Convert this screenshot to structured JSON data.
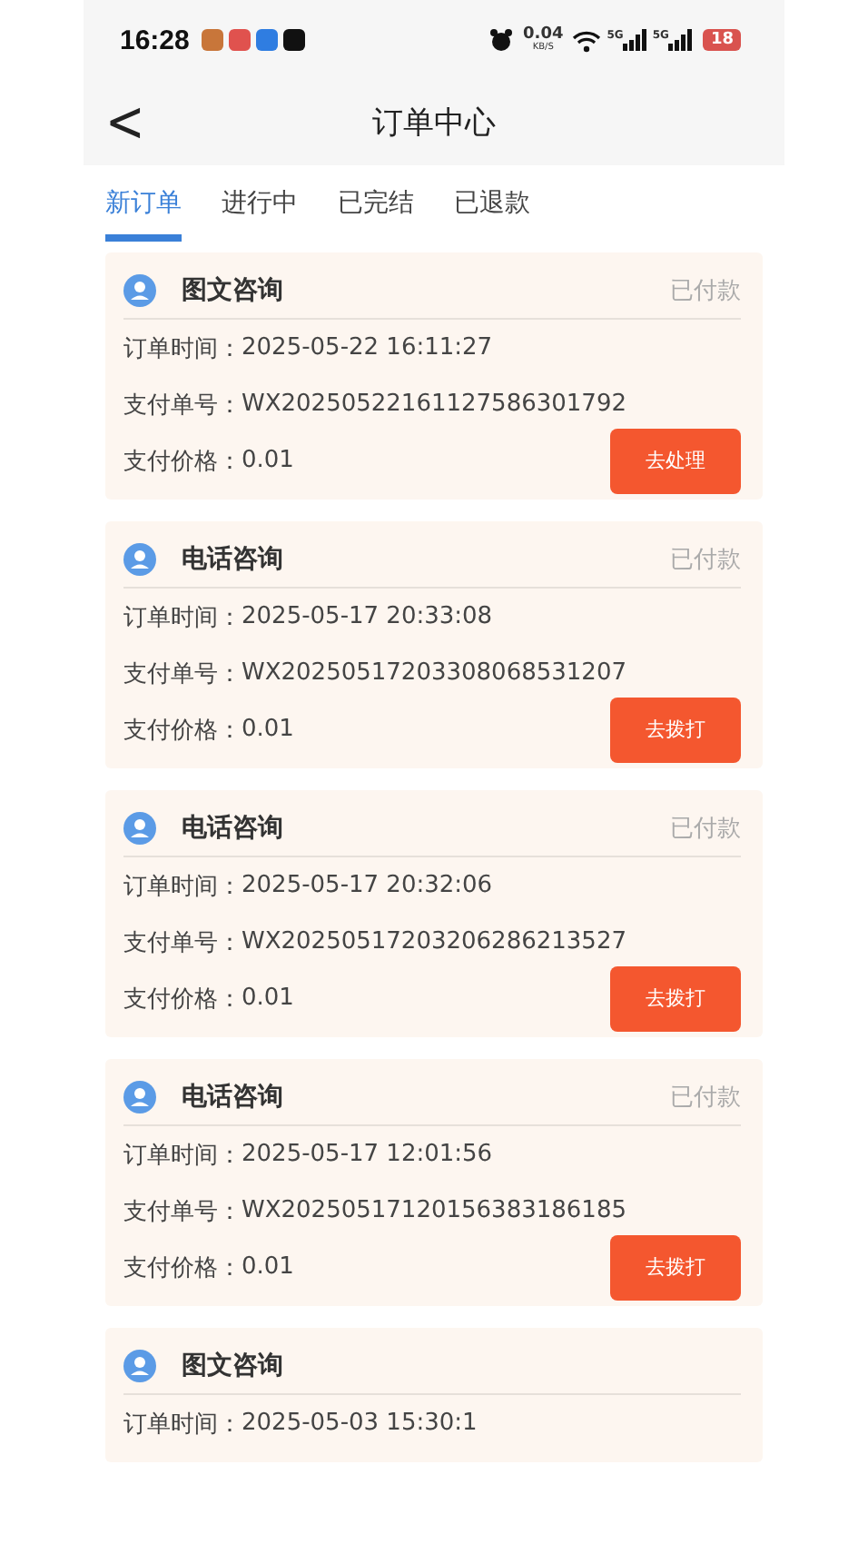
{
  "status_bar": {
    "time": "16:28",
    "app_icons": [
      {
        "color": "#c8763a"
      },
      {
        "color": "#e0524e"
      },
      {
        "color": "#2f7de1"
      },
      {
        "color": "#111111"
      }
    ],
    "speed": "0.04",
    "speed_unit": "KB/S",
    "signals": [
      {
        "label": "5G"
      },
      {
        "label": "5G"
      }
    ],
    "battery": "18"
  },
  "nav": {
    "back": "<",
    "title": "订单中心"
  },
  "tabs": [
    {
      "label": "新订单",
      "selected": true
    },
    {
      "label": "进行中",
      "selected": false
    },
    {
      "label": "已完结",
      "selected": false
    },
    {
      "label": "已退款",
      "selected": false
    }
  ],
  "orders": [
    {
      "title": "图文咨询",
      "status": "已付款",
      "rows": [
        {
          "label": "订单时间：",
          "value": "2025-05-22 16:11:27"
        },
        {
          "label": "支付单号：",
          "value": "WX20250522161127586301792"
        },
        {
          "label": "支付价格：",
          "value": "0.01"
        }
      ],
      "button": "去处理"
    },
    {
      "title": "电话咨询",
      "status": "已付款",
      "rows": [
        {
          "label": "订单时间：",
          "value": "2025-05-17 20:33:08"
        },
        {
          "label": "支付单号：",
          "value": "WX20250517203308068531207"
        },
        {
          "label": "支付价格：",
          "value": "0.01"
        }
      ],
      "button": "去拨打"
    },
    {
      "title": "电话咨询",
      "status": "已付款",
      "rows": [
        {
          "label": "订单时间：",
          "value": "2025-05-17 20:32:06"
        },
        {
          "label": "支付单号：",
          "value": "WX20250517203206286213527"
        },
        {
          "label": "支付价格：",
          "value": "0.01"
        }
      ],
      "button": "去拨打"
    },
    {
      "title": "电话咨询",
      "status": "已付款",
      "rows": [
        {
          "label": "订单时间：",
          "value": "2025-05-17 12:01:56"
        },
        {
          "label": "支付单号：",
          "value": "WX20250517120156383186185"
        },
        {
          "label": "支付价格：",
          "value": "0.01"
        }
      ],
      "button": "去拨打"
    },
    {
      "title": "图文咨询",
      "rows": [
        {
          "label": "订单时间：",
          "value": "2025-05-03 15:30:1"
        }
      ]
    }
  ]
}
